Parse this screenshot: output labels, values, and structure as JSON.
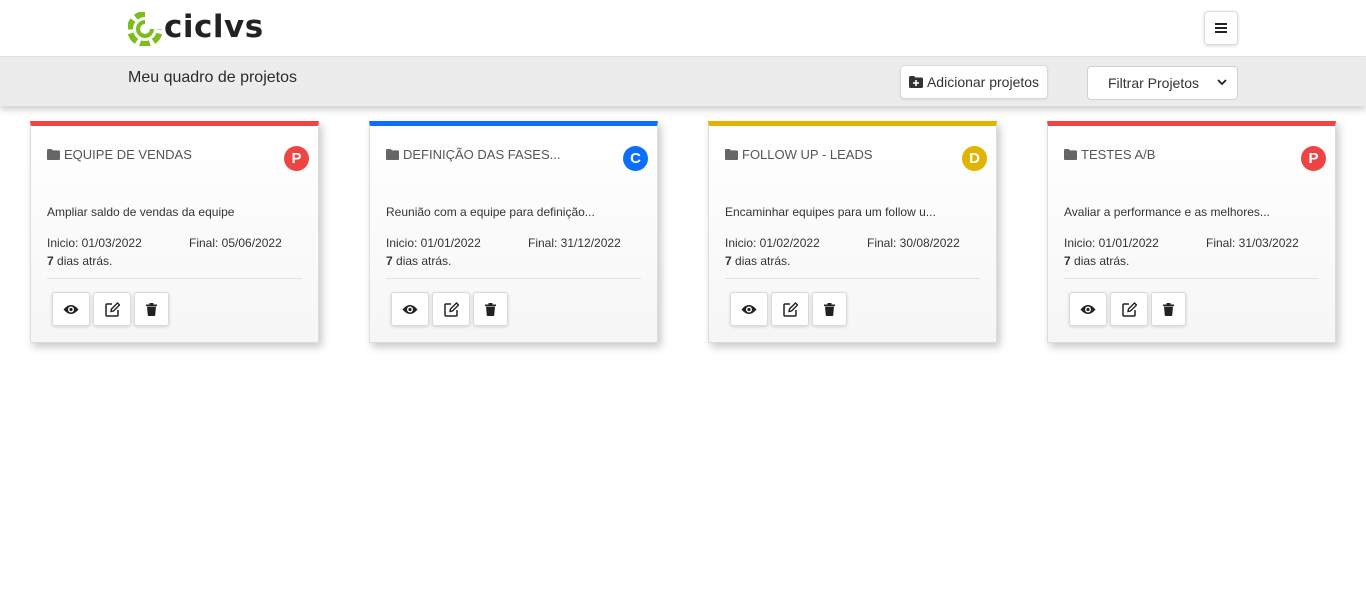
{
  "header": {
    "logo_text": "ciclvs",
    "menu_icon": "hamburger-icon"
  },
  "subbar": {
    "title": "Meu quadro de projetos",
    "add_label": "Adicionar projetos",
    "filter_value": "Filtrar Projetos"
  },
  "colors": {
    "red": "#ef4444",
    "blue": "#0d6efd",
    "yellow": "#e0b400"
  },
  "projects": [
    {
      "title": "EQUIPE DE VENDAS",
      "badge": "P",
      "color": "#ef4444",
      "description": "Ampliar saldo de vendas da equipe",
      "inicio": "Inicio: 01/03/2022",
      "final": "Final: 05/06/2022",
      "days": "7",
      "ago": " dias atrás."
    },
    {
      "title": "DEFINIÇÃO DAS FASES...",
      "badge": "C",
      "color": "#0d6efd",
      "description": "Reunião com a equipe para definição...",
      "inicio": "Inicio: 01/01/2022",
      "final": "Final: 31/12/2022",
      "days": "7",
      "ago": " dias atrás."
    },
    {
      "title": "FOLLOW UP - LEADS",
      "badge": "D",
      "color": "#e0b400",
      "description": "Encaminhar equipes para um follow u...",
      "inicio": "Inicio: 01/02/2022",
      "final": "Final: 30/08/2022",
      "days": "7",
      "ago": " dias atrás."
    },
    {
      "title": "TESTES A/B",
      "badge": "P",
      "color": "#ef4444",
      "description": "Avaliar a performance e as melhores...",
      "inicio": "Inicio: 01/01/2022",
      "final": "Final: 31/03/2022",
      "days": "7",
      "ago": " dias atrás."
    }
  ]
}
